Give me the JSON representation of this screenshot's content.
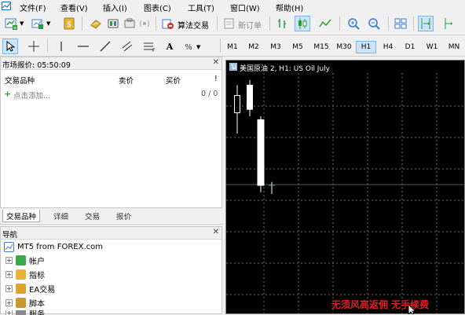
{
  "menubar": {
    "items": [
      "文件(F)",
      "查看(V)",
      "插入(I)",
      "图表(C)",
      "工具(T)",
      "窗口(W)",
      "帮助(H)"
    ]
  },
  "toolbar": {
    "algo_trading_label": "算法交易",
    "new_order_label": "新订单",
    "timeframes": [
      "M1",
      "M2",
      "M3",
      "M5",
      "M15",
      "M30",
      "H1",
      "H4",
      "D1",
      "W1",
      "MN"
    ],
    "active_timeframe": "H1"
  },
  "market_watch": {
    "title": "市场报价: 05:50:09",
    "columns": {
      "symbol": "交易品种",
      "bid": "卖价",
      "ask": "买价",
      "flag": "!"
    },
    "add_label": "点击添加...",
    "count": "0 / 0",
    "tabs": [
      "交易品种",
      "详细",
      "交易",
      "报价"
    ],
    "active_tab": "交易品种"
  },
  "navigator": {
    "title": "导航",
    "root": "MT5 from FOREX.com",
    "items": [
      {
        "label": "帐户",
        "icon": "accounts-icon"
      },
      {
        "label": "指标",
        "icon": "indicators-icon"
      },
      {
        "label": "EA交易",
        "icon": "expert-advisors-icon"
      },
      {
        "label": "脚本",
        "icon": "scripts-icon"
      },
      {
        "label": "服务",
        "icon": "services-icon"
      }
    ]
  },
  "chart": {
    "title": "美国原油 2, H1: US Oil July",
    "candles": [
      {
        "open": 0.72,
        "close": 0.82,
        "high": 0.88,
        "low": 0.6
      },
      {
        "open": 0.88,
        "close": 0.74,
        "high": 0.91,
        "low": 0.7
      },
      {
        "open": 0.68,
        "close": 0.3,
        "high": 0.7,
        "low": 0.26
      },
      {
        "open": 0.3,
        "close": 0.3,
        "high": 0.32,
        "low": 0.25
      }
    ]
  },
  "watermark": "无须风高返佣 无手续费",
  "colors": {
    "chart_bg": "#000000",
    "grid": "#6e6e6e",
    "bull": "#ffffff",
    "bear": "#ffffff",
    "accent": "#0078d7",
    "watermark": "#e02020"
  }
}
